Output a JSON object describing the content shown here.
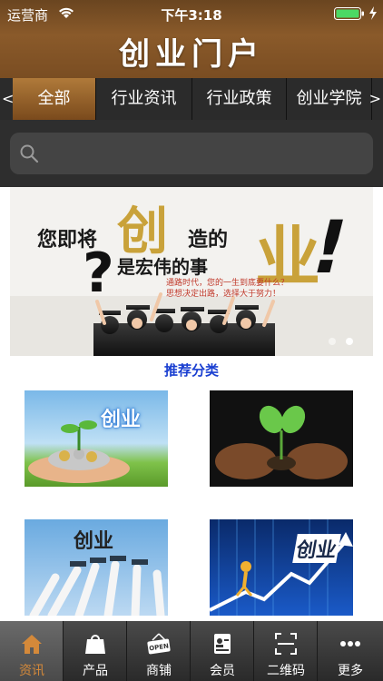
{
  "status_bar": {
    "carrier": "运营商",
    "time": "下午3:18"
  },
  "header": {
    "title": "创业门户"
  },
  "tabs": {
    "left_arrow": "<",
    "right_arrow": ">",
    "items": [
      {
        "label": "全部"
      },
      {
        "label": "行业资讯"
      },
      {
        "label": "行业政策"
      },
      {
        "label": "创业学院"
      }
    ]
  },
  "search": {
    "placeholder": ""
  },
  "banner": {
    "line1a": "您即将",
    "big1": "创",
    "line1b": "造的",
    "line2": "是宏伟的事",
    "big2": "业",
    "exclaim": "!",
    "small_line1": "通路时代，您的一生到底要什么？",
    "small_line2": "思想决定出路，选择大于努力！",
    "slide_count": 2,
    "active_slide": 2
  },
  "section": {
    "title": "推荐分类"
  },
  "categories": [
    {
      "label": "创业"
    },
    {
      "label": ""
    },
    {
      "label": "创业"
    },
    {
      "label": "创业"
    }
  ],
  "bottom_nav": [
    {
      "label": "资讯",
      "icon": "home-icon"
    },
    {
      "label": "产品",
      "icon": "bag-icon"
    },
    {
      "label": "商铺",
      "icon": "open-sign-icon"
    },
    {
      "label": "会员",
      "icon": "member-card-icon"
    },
    {
      "label": "二维码",
      "icon": "qr-scan-icon"
    },
    {
      "label": "更多",
      "icon": "more-icon"
    }
  ],
  "colors": {
    "brand_brown": "#8a5a2a",
    "active_nav": "#d4893a",
    "section_title": "#1a3fd1",
    "battery_green": "#4cd964"
  }
}
